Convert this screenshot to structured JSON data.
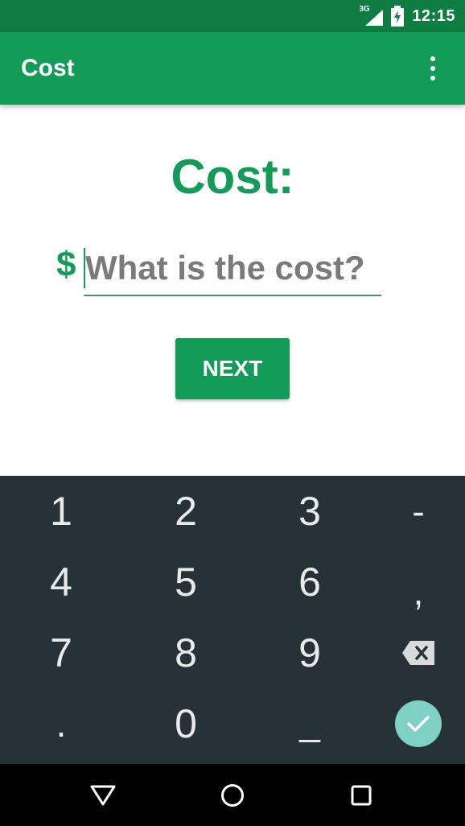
{
  "status_bar": {
    "network": "3G",
    "time": "12:15",
    "icons": [
      "signal-icon",
      "battery-charging-icon"
    ]
  },
  "app_bar": {
    "title": "Cost",
    "menu_icon": "more-vert-icon"
  },
  "form": {
    "heading": "Cost:",
    "currency": "$",
    "input_value": "",
    "input_placeholder": "What is the cost?",
    "next_label": "NEXT"
  },
  "keyboard": {
    "rows": [
      [
        "1",
        "2",
        "3",
        "-"
      ],
      [
        "4",
        "5",
        "6",
        ","
      ],
      [
        "7",
        "8",
        "9",
        "backspace"
      ],
      [
        ".",
        "0",
        "_",
        "done"
      ]
    ],
    "labels": {
      "k1": "1",
      "k2": "2",
      "k3": "3",
      "dash": "-",
      "k4": "4",
      "k5": "5",
      "k6": "6",
      "comma": ",",
      "k7": "7",
      "k8": "8",
      "k9": "9",
      "dot": ".",
      "k0": "0",
      "space": "_"
    },
    "done_color": "#7fd0c5"
  },
  "nav_bar": {
    "buttons": [
      "back-icon",
      "home-icon",
      "recents-icon"
    ]
  },
  "colors": {
    "primary": "#139c58",
    "primary_dark": "#0f7d42",
    "keyboard_bg": "#263238"
  }
}
